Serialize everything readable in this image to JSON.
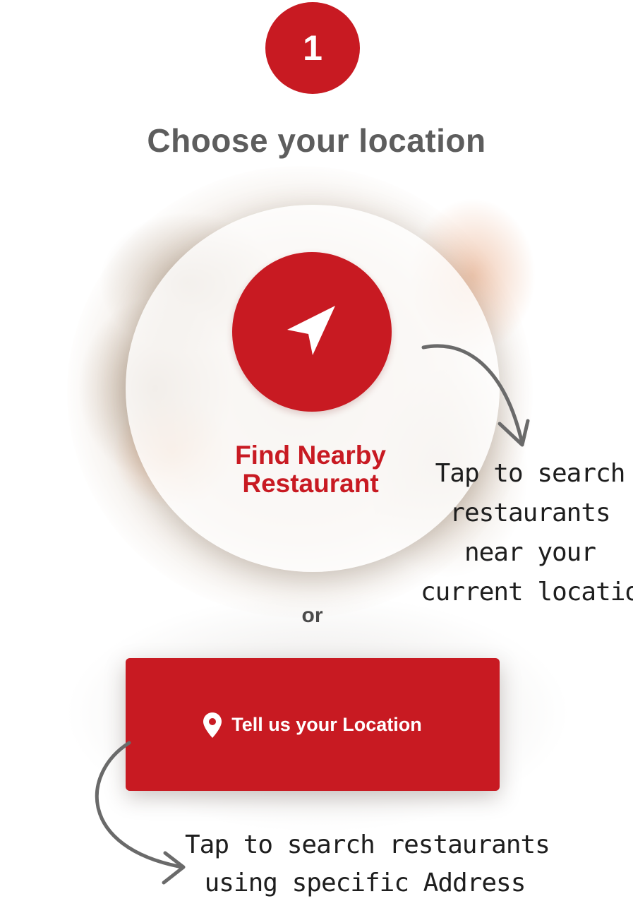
{
  "step": {
    "number": "1",
    "title": "Choose your location"
  },
  "nearby": {
    "icon": "navigation-arrow-icon",
    "label_line1": "Find Nearby",
    "label_line2": "Restaurant"
  },
  "divider_text": "or",
  "location_button": {
    "icon": "map-pin-icon",
    "label": "Tell us your Location"
  },
  "annotations": {
    "nearby_hint": [
      "Tap to search",
      "restaurants",
      "near your",
      "current location"
    ],
    "address_hint": [
      "Tap to search restaurants",
      "using specific Address"
    ]
  },
  "colors": {
    "accent_red": "#c81a22",
    "title_gray": "#5d5d5d",
    "handwriting": "#1e1e1e",
    "arrow_gray": "#6a6a6a"
  }
}
